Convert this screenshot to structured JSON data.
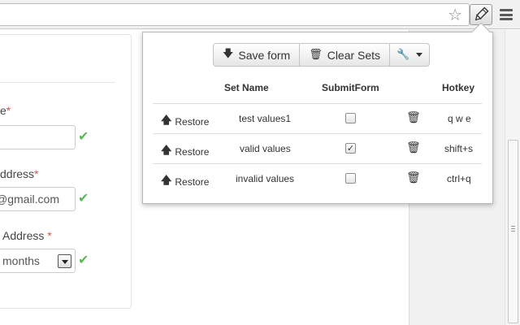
{
  "form": {
    "field1_label": "e",
    "field1_req": "*",
    "field2_label": "ddress",
    "field2_req": "*",
    "field2_value": "@gmail.com",
    "field3_label": "Address",
    "field3_req": "*",
    "field3_value": "months"
  },
  "popup": {
    "save_label": "Save form",
    "clear_label": "Clear Sets",
    "headers": {
      "set_name": "Set Name",
      "submit_form": "SubmitForm",
      "hotkey": "Hotkey"
    },
    "rows": [
      {
        "restore": "Restore",
        "name": "test values1",
        "submit": false,
        "hotkey": "q w e"
      },
      {
        "restore": "Restore",
        "name": "valid values",
        "submit": true,
        "hotkey": "shift+s"
      },
      {
        "restore": "Restore",
        "name": "invalid values",
        "submit": false,
        "hotkey": "ctrl+q"
      }
    ]
  },
  "icons": {
    "star": "star-icon",
    "pencil": "pencil-icon",
    "menu": "menu-icon",
    "save": "arrow-down-icon",
    "clear": "trash-icon",
    "wrench": "wrench-icon",
    "restore": "arrow-up-icon",
    "check": "checkmark-icon"
  },
  "colors": {
    "check_green": "#5cb85c",
    "required_red": "#d9534f"
  }
}
